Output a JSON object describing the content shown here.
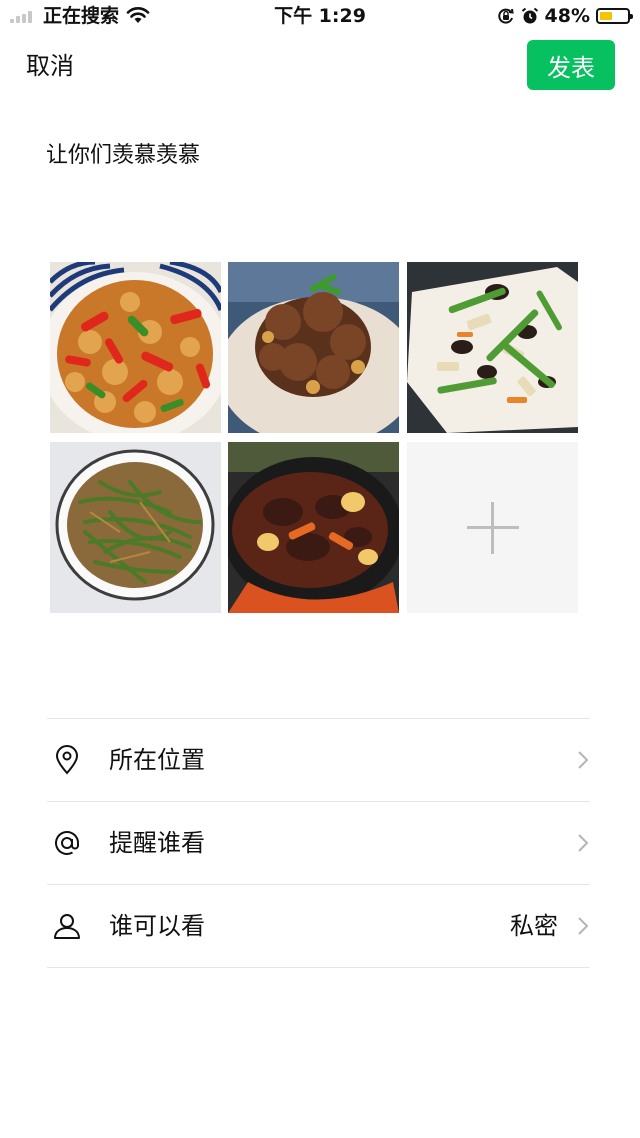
{
  "status_bar": {
    "carrier": "正在搜索",
    "time": "下午 1:29",
    "battery_percent": "48%",
    "battery_level": 0.48,
    "icons": [
      "signal-icon",
      "wifi-icon",
      "orientation-lock-icon",
      "alarm-icon",
      "battery-icon"
    ]
  },
  "nav": {
    "cancel_label": "取消",
    "publish_label": "发表",
    "accent_color": "#07c160"
  },
  "post": {
    "text": "让你们羡慕羡慕"
  },
  "photos": [
    {
      "name": "photo-spicy-chicken"
    },
    {
      "name": "photo-braised-meat"
    },
    {
      "name": "photo-stir-fry-vegetables"
    },
    {
      "name": "photo-green-beans"
    },
    {
      "name": "photo-stew-pot"
    }
  ],
  "add_photo": {
    "icon": "plus-icon"
  },
  "options": [
    {
      "name": "location",
      "label": "所在位置",
      "value": "",
      "icon": "location-pin-icon"
    },
    {
      "name": "mention",
      "label": "提醒谁看",
      "value": "",
      "icon": "at-sign-icon"
    },
    {
      "name": "visibility",
      "label": "谁可以看",
      "value": "私密",
      "icon": "person-icon"
    }
  ]
}
